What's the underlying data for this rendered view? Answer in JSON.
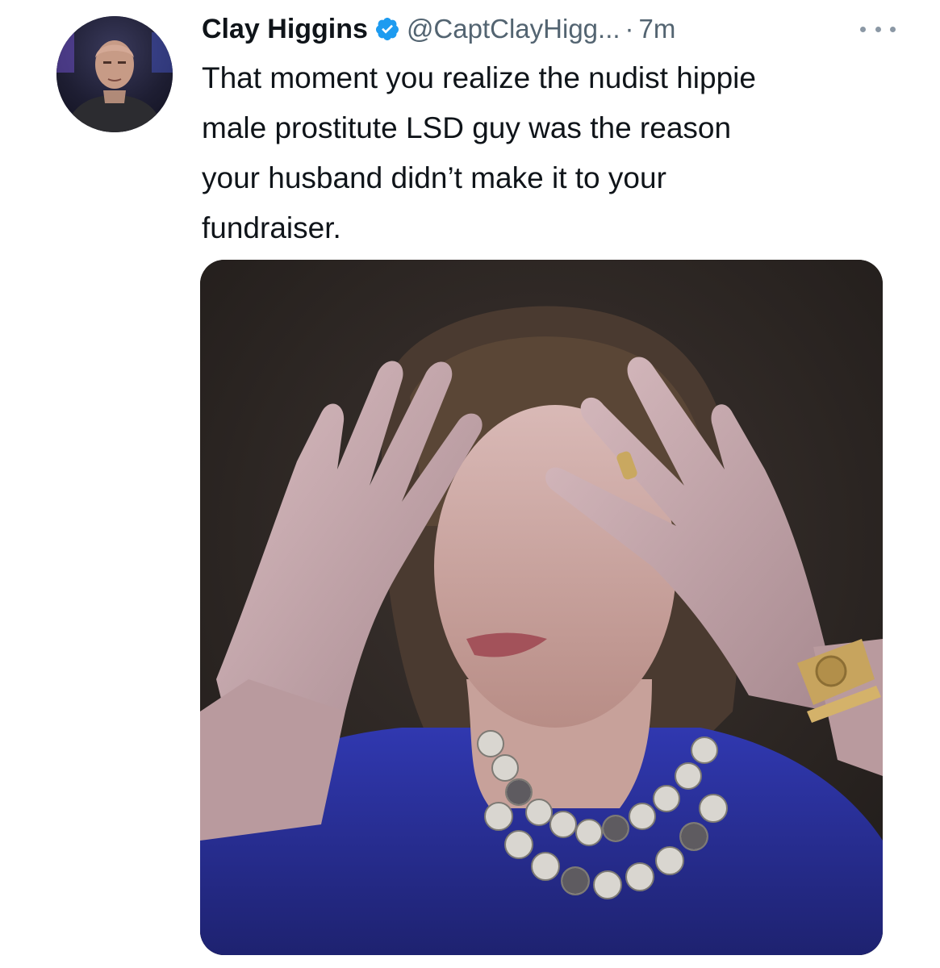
{
  "tweet": {
    "author": {
      "display_name": "Clay Higgins",
      "handle": "@CaptClayHigg...",
      "verified": true,
      "avatar_icon": "profile-photo"
    },
    "separator": "·",
    "timestamp": "7m",
    "more_icon": "more-horizontal-icon",
    "text_lines": [
      "That moment you realize the nudist hippie",
      "male prostitute LSD guy was the reason",
      "your husband didn’t make it to your",
      "fundraiser."
    ],
    "media": {
      "kind": "photo"
    }
  },
  "colors": {
    "text_primary": "#0f1419",
    "text_secondary": "#536471",
    "verified_blue": "#1d9bf0",
    "dress_blue": "#2a2f9c"
  }
}
